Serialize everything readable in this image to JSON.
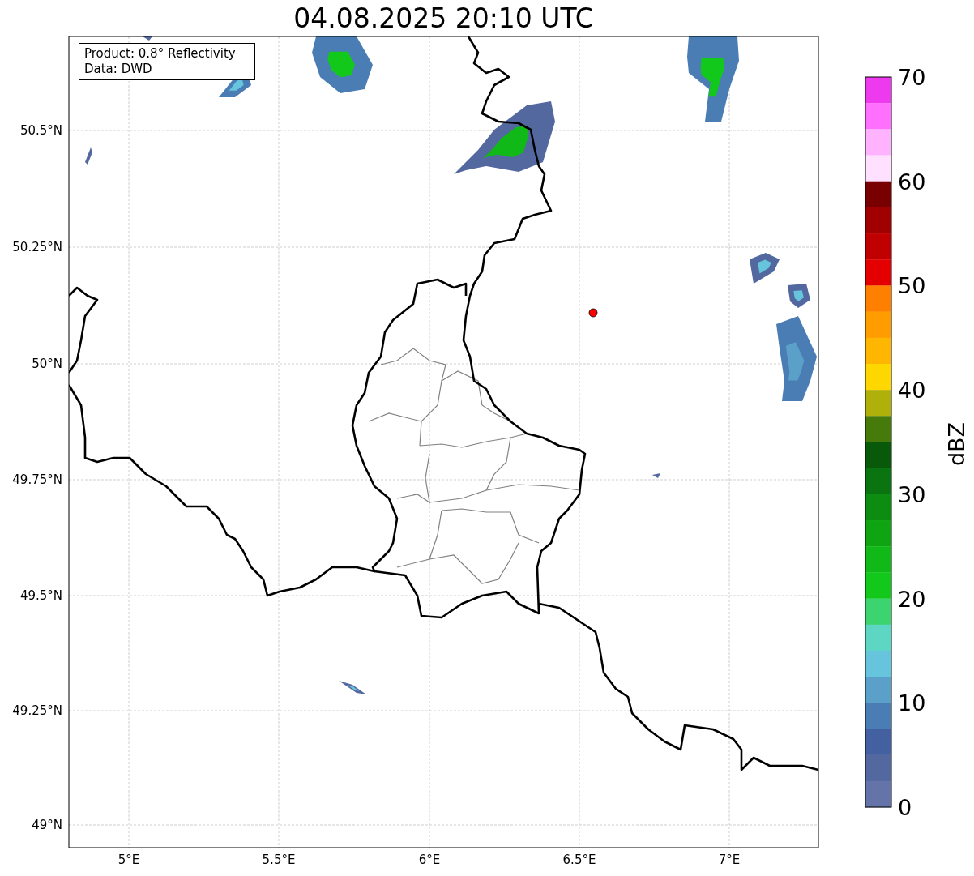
{
  "title": "04.08.2025 20:10 UTC",
  "info_box": [
    "Product: 0.8° Reflectivity",
    "Data: DWD"
  ],
  "y_ticks": [
    "50.5°N",
    "50.25°N",
    "50°N",
    "49.75°N",
    "49.5°N",
    "49.25°N",
    "49°N"
  ],
  "x_ticks": [
    "5°E",
    "5.5°E",
    "6°E",
    "6.5°E",
    "7°E"
  ],
  "colorbar": {
    "label": "dBZ",
    "ticks": [
      "70",
      "60",
      "50",
      "40",
      "30",
      "20",
      "10",
      "0"
    ],
    "bins": [
      {
        "color": "#ee3aee"
      },
      {
        "color": "#ff70ff"
      },
      {
        "color": "#ffb3ff"
      },
      {
        "color": "#ffe0ff"
      },
      {
        "color": "#780000"
      },
      {
        "color": "#a00000"
      },
      {
        "color": "#c00000"
      },
      {
        "color": "#e40000"
      },
      {
        "color": "#ff8000"
      },
      {
        "color": "#ff9c00"
      },
      {
        "color": "#ffb600"
      },
      {
        "color": "#ffd700"
      },
      {
        "color": "#b0b00a"
      },
      {
        "color": "#467a0a"
      },
      {
        "color": "#085a0a"
      },
      {
        "color": "#0a7510"
      },
      {
        "color": "#0c8c10"
      },
      {
        "color": "#0ea412"
      },
      {
        "color": "#10b818"
      },
      {
        "color": "#12c81a"
      },
      {
        "color": "#3cd46e"
      },
      {
        "color": "#5ed6c4"
      },
      {
        "color": "#66c4dc"
      },
      {
        "color": "#5aa0c8"
      },
      {
        "color": "#4b7db5"
      },
      {
        "color": "#4360a0"
      },
      {
        "color": "#5468a0"
      },
      {
        "color": "#6474a8"
      }
    ]
  }
}
